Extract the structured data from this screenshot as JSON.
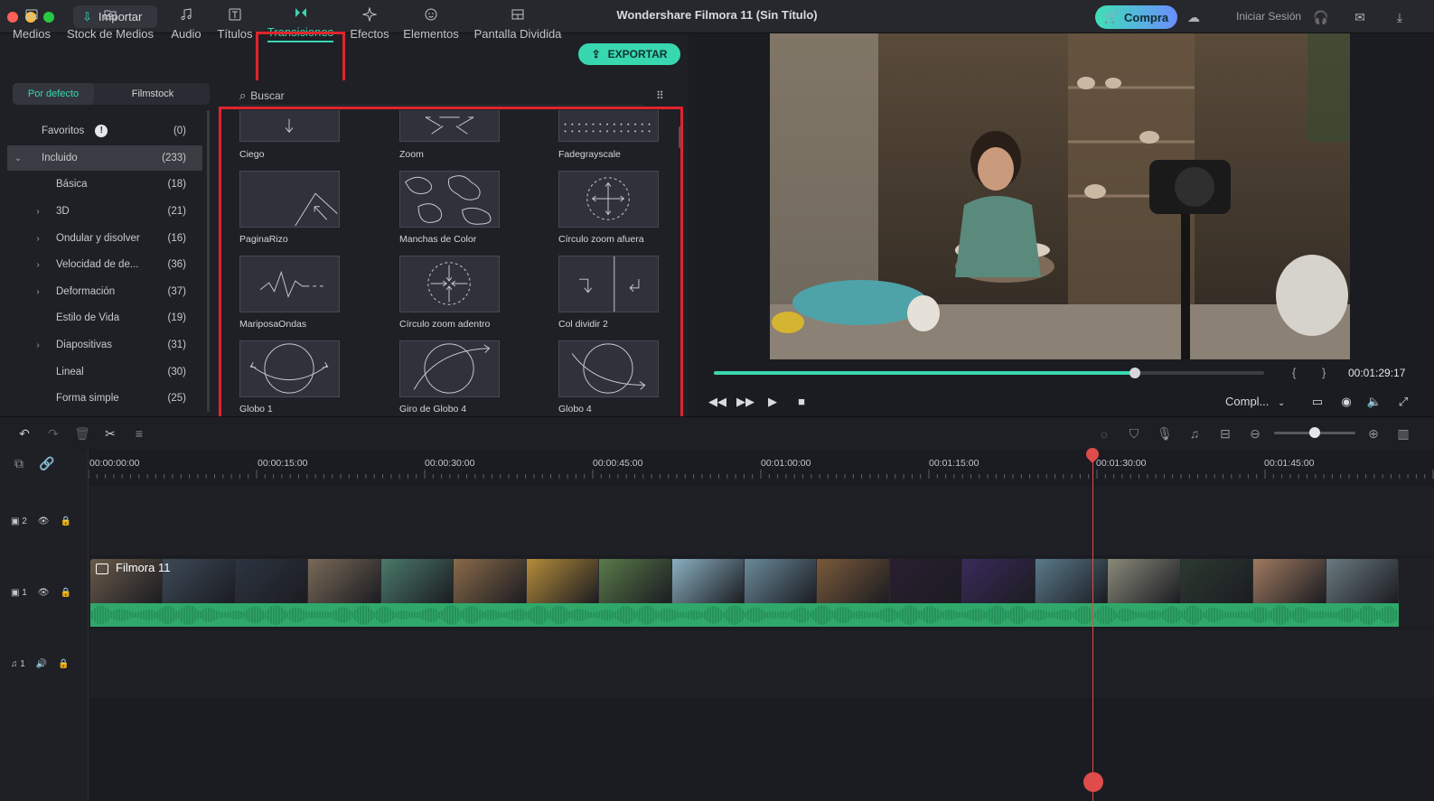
{
  "window": {
    "title": "Wondershare Filmora 11 (Sin Título)"
  },
  "titlebar": {
    "import_label": "Importar",
    "buy_label": "Compra",
    "login_label": "Iniciar Sesión",
    "icons": [
      "cloud-icon",
      "headset-icon",
      "mail-icon",
      "download-icon"
    ]
  },
  "tabs": [
    {
      "label": "Medios",
      "icon": "media-icon"
    },
    {
      "label": "Stock de Medios",
      "icon": "stock-icon"
    },
    {
      "label": "Audio",
      "icon": "music-icon"
    },
    {
      "label": "Títulos",
      "icon": "title-icon"
    },
    {
      "label": "Transiciones",
      "icon": "transition-icon",
      "active": true
    },
    {
      "label": "Efectos",
      "icon": "effects-icon"
    },
    {
      "label": "Elementos",
      "icon": "elements-icon"
    },
    {
      "label": "Pantalla Dividida",
      "icon": "split-screen-icon"
    }
  ],
  "export_label": "EXPORTAR",
  "segment": {
    "default_label": "Por defecto",
    "filmstock_label": "Filmstock"
  },
  "categories": [
    {
      "label": "Favoritos",
      "count": "(0)",
      "chevron": "",
      "info": true
    },
    {
      "label": "Incluido",
      "count": "(233)",
      "chevron": "⌄",
      "selected": true
    },
    {
      "label": "Básica",
      "count": "(18)",
      "chevron": ""
    },
    {
      "label": "3D",
      "count": "(21)",
      "chevron": "›"
    },
    {
      "label": "Ondular y disolver",
      "count": "(16)",
      "chevron": "›"
    },
    {
      "label": "Velocidad de de...",
      "count": "(36)",
      "chevron": "›"
    },
    {
      "label": "Deformación",
      "count": "(37)",
      "chevron": "›"
    },
    {
      "label": "Estilo de Vida",
      "count": "(19)",
      "chevron": ""
    },
    {
      "label": "Diapositivas",
      "count": "(31)",
      "chevron": "›"
    },
    {
      "label": "Lineal",
      "count": "(30)",
      "chevron": ""
    },
    {
      "label": "Forma simple",
      "count": "(25)",
      "chevron": ""
    }
  ],
  "search": {
    "placeholder": "Buscar"
  },
  "transitions": [
    {
      "name": "Ciego"
    },
    {
      "name": "Zoom"
    },
    {
      "name": "Fadegrayscale"
    },
    {
      "name": "PaginaRizo"
    },
    {
      "name": "Manchas de Color"
    },
    {
      "name": "Círculo zoom afuera"
    },
    {
      "name": "MariposaOndas"
    },
    {
      "name": "Círculo zoom adentro"
    },
    {
      "name": "Col dividir 2"
    },
    {
      "name": "Globo 1"
    },
    {
      "name": "Giro de Globo 4"
    },
    {
      "name": "Globo 4"
    }
  ],
  "player": {
    "timecode": "00:01:29:17",
    "progress": 0.765,
    "quality_label": "Compl...",
    "bracket_in": "{",
    "bracket_out": "}"
  },
  "ruler": [
    "00:00:00:00",
    "00:00:15:00",
    "00:00:30:00",
    "00:00:45:00",
    "00:01:00:00",
    "00:01:15:00",
    "00:01:30:00",
    "00:01:45:00"
  ],
  "tracks": [
    {
      "id": "video-2",
      "num": "2"
    },
    {
      "id": "video-1",
      "num": "1"
    },
    {
      "id": "audio-1",
      "num": "1"
    }
  ],
  "clip": {
    "label": "Filmora 11"
  },
  "zoom_level": 0.5,
  "colors": {
    "accent": "#38d7b0",
    "highlight": "#e0242d",
    "playhead": "#e04b4b",
    "audio": "#2fa86a"
  }
}
